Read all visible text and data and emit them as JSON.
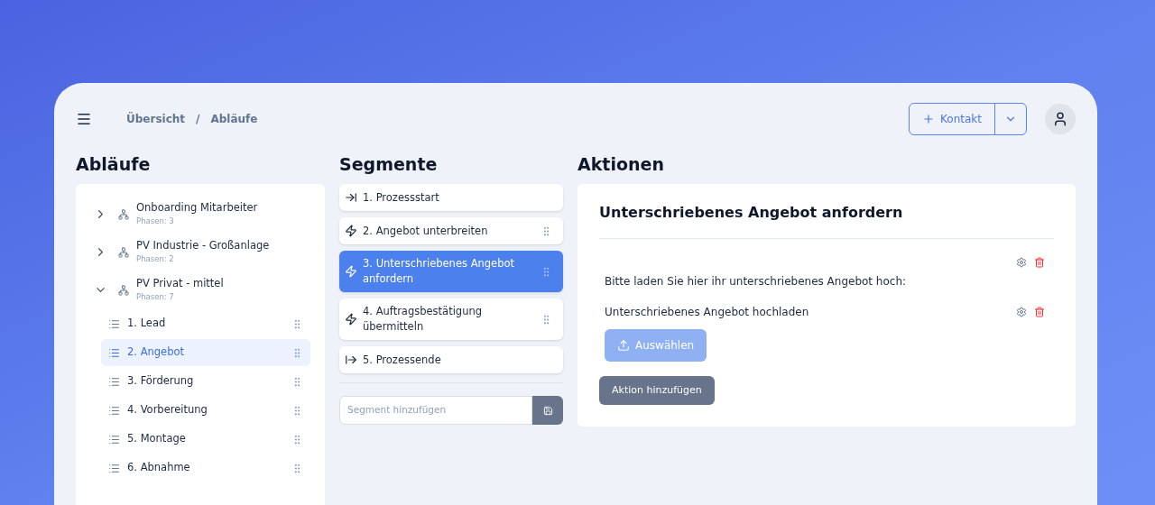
{
  "breadcrumb": [
    "Übersicht",
    "/",
    "Abläufe"
  ],
  "contact_button": {
    "label": "Kontakt"
  },
  "flows": {
    "title": "Abläufe",
    "items": [
      {
        "name": "Onboarding Mitarbeiter",
        "phases": "Phasen: 3",
        "expanded": false
      },
      {
        "name": "PV Industrie - Großanlage",
        "phases": "Phasen: 2",
        "expanded": false
      },
      {
        "name": "PV Privat - mittel",
        "phases": "Phasen: 7",
        "expanded": true,
        "children": [
          {
            "label": "1. Lead",
            "selected": false
          },
          {
            "label": "2. Angebot",
            "selected": true
          },
          {
            "label": "3. Förderung",
            "selected": false
          },
          {
            "label": "4. Vorbereitung",
            "selected": false
          },
          {
            "label": "5. Montage",
            "selected": false
          },
          {
            "label": "6. Abnahme",
            "selected": false
          }
        ]
      }
    ]
  },
  "segments": {
    "title": "Segmente",
    "items": [
      {
        "kind": "start",
        "label": "1. Prozessstart",
        "selected": false
      },
      {
        "kind": "action",
        "label": "2. Angebot unterbreiten",
        "selected": false
      },
      {
        "kind": "action",
        "label": "3. Unterschriebenes Angebot anfordern",
        "selected": true
      },
      {
        "kind": "action",
        "label": "4. Auftragsbestätigung übermitteln",
        "selected": false
      },
      {
        "kind": "end",
        "label": "5. Prozessende",
        "selected": false
      }
    ],
    "add_placeholder": "Segment hinzufügen"
  },
  "actions": {
    "title": "Aktionen",
    "card_title": "Unterschriebenes Angebot anfordern",
    "items": [
      {
        "kind": "text",
        "text": "Bitte laden Sie hier ihr unterschriebenes Angebot hoch:"
      },
      {
        "kind": "upload",
        "text": "Unterschriebenes Angebot hochladen",
        "button": "Auswählen"
      }
    ],
    "add_button": "Aktion hinzufügen"
  }
}
